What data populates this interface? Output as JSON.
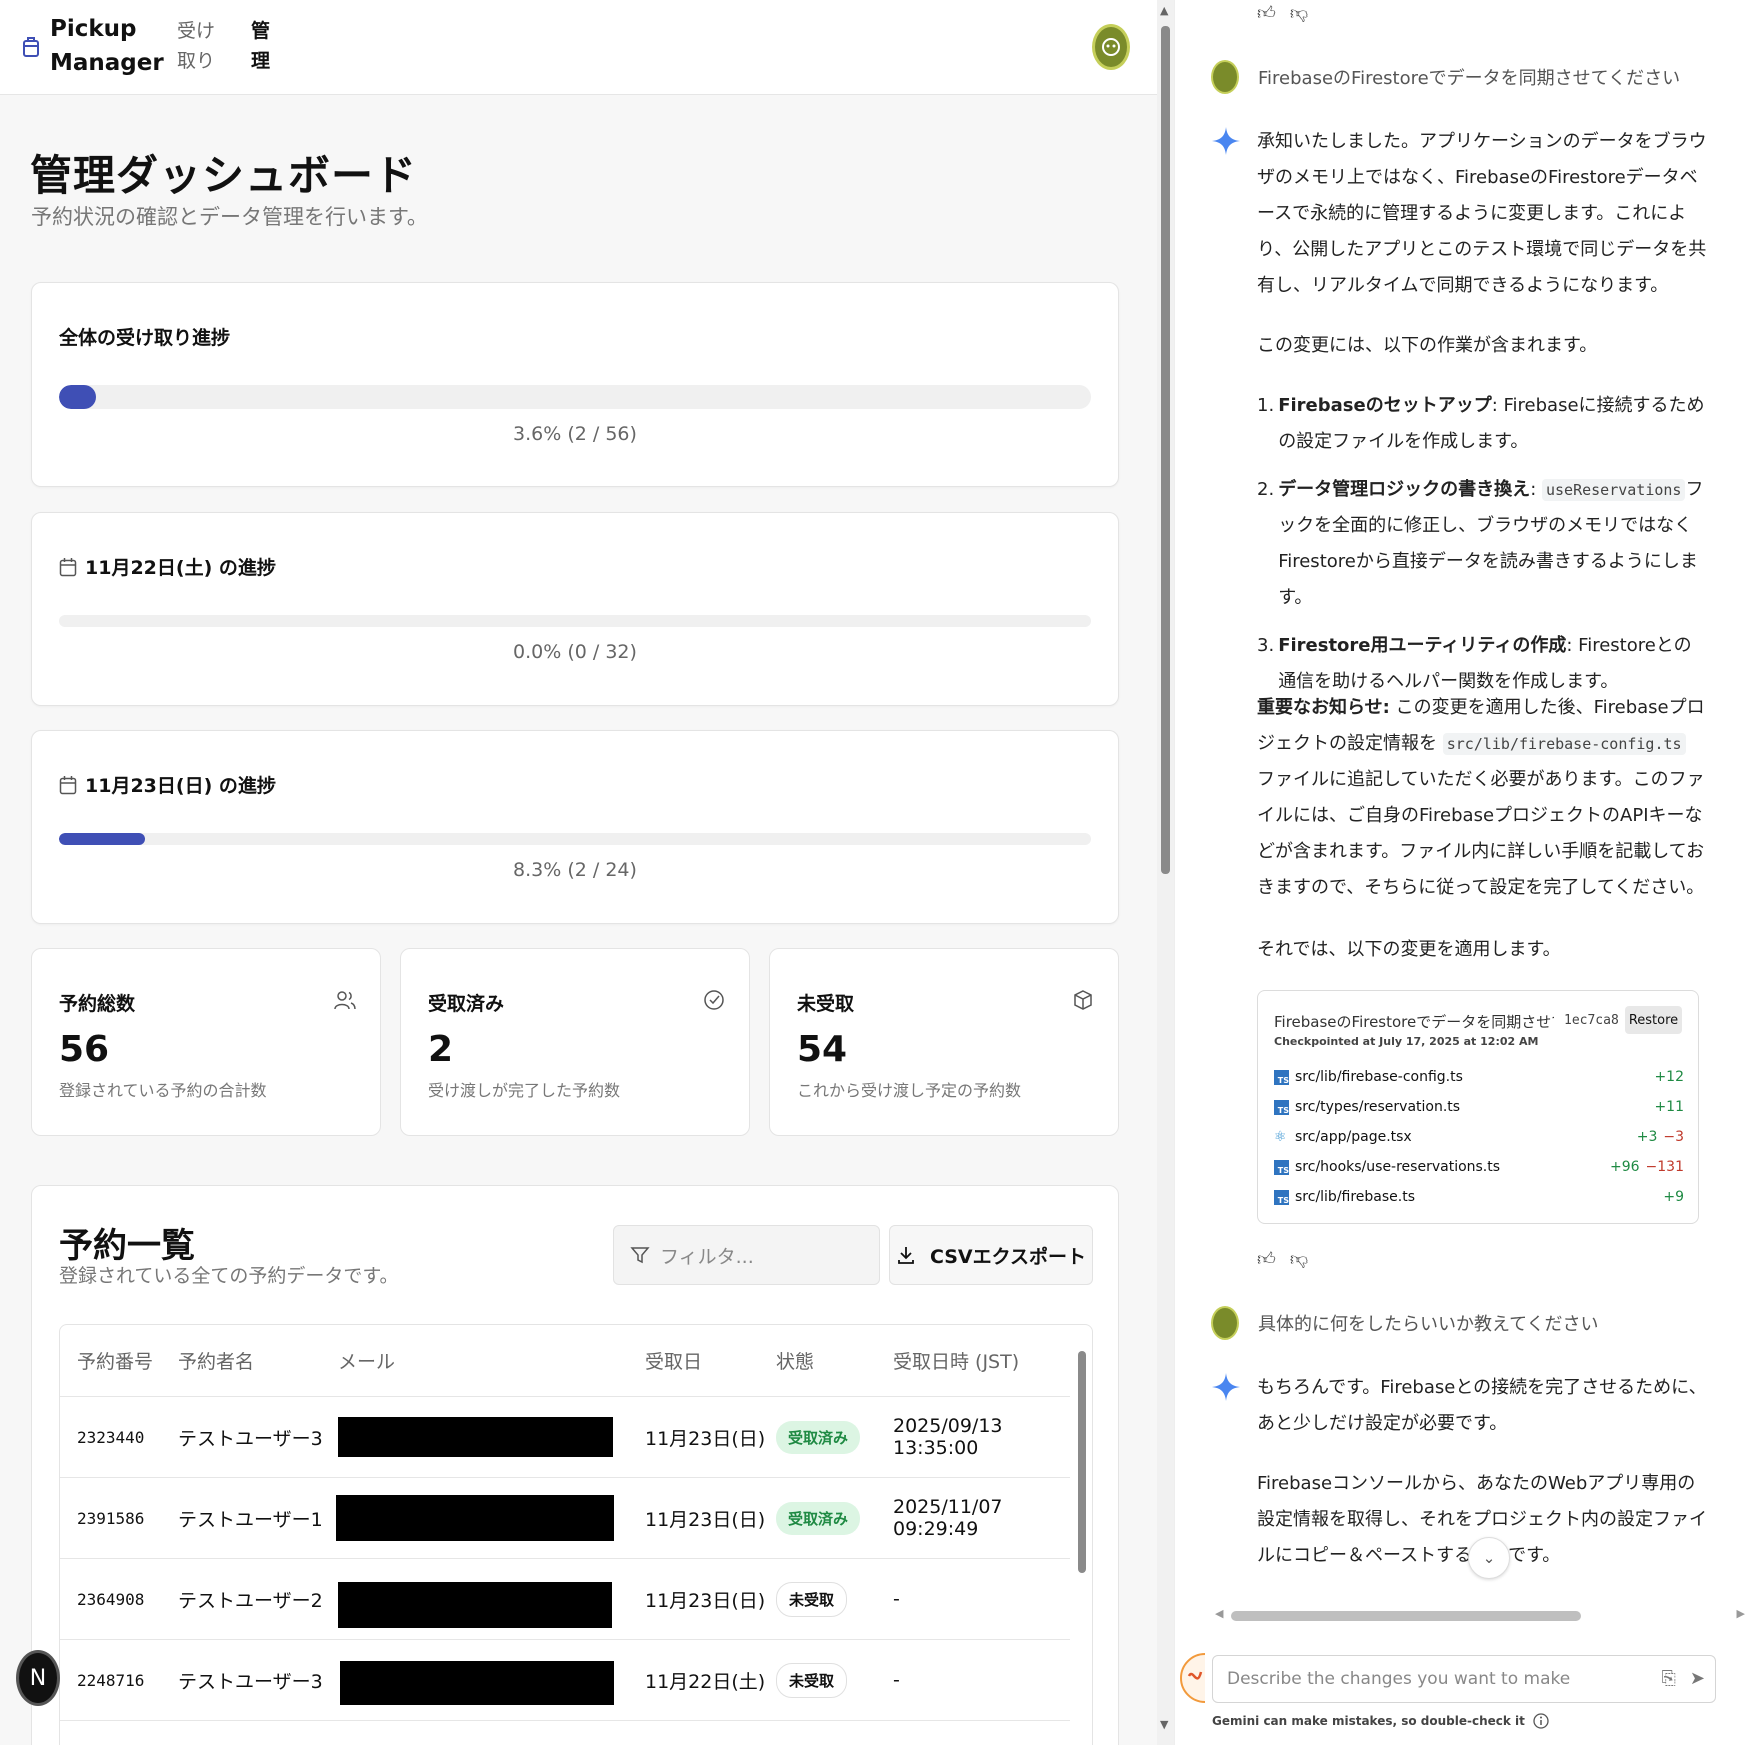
{
  "app": {
    "brand_line1": "Pickup",
    "brand_line2": "Manager",
    "nav": [
      {
        "line1": "受け",
        "line2": "取り"
      },
      {
        "line1": "管",
        "line2": "理"
      }
    ],
    "page_title": "管理ダッシュボード",
    "page_subtitle": "予約状況の確認とデータ管理を行います。",
    "progress": [
      {
        "title": "全体の受け取り進捗",
        "percent_text": "3.6% (2 / 56)",
        "fraction": 0.036
      },
      {
        "title": "11月22日(土) の進捗",
        "percent_text": "0.0% (0 / 32)",
        "fraction": 0.0
      },
      {
        "title": "11月23日(日) の進捗",
        "percent_text": "8.3% (2 / 24)",
        "fraction": 0.083
      }
    ],
    "stats": [
      {
        "label": "予約総数",
        "value": "56",
        "sub": "登録されている予約の合計数",
        "icon": "users-icon"
      },
      {
        "label": "受取済み",
        "value": "2",
        "sub": "受け渡しが完了した予約数",
        "icon": "check-circle-icon"
      },
      {
        "label": "未受取",
        "value": "54",
        "sub": "これから受け渡し予定の予約数",
        "icon": "package-icon"
      }
    ],
    "list": {
      "title": "予約一覧",
      "subtitle": "登録されている全ての予約データです。",
      "filter_placeholder": "フィルタ...",
      "csv_label": "CSVエクスポート",
      "headers": [
        "予約番号",
        "予約者名",
        "メール",
        "受取日",
        "状態",
        "受取日時 (JST)"
      ],
      "rows": [
        {
          "id": "2323440",
          "name": "テストユーザー3",
          "date": "11月23日(日)",
          "status": "受取済み",
          "status_type": "done",
          "time": "2025/09/13 13:35:00"
        },
        {
          "id": "2391586",
          "name": "テストユーザー1",
          "date": "11月23日(日)",
          "status": "受取済み",
          "status_type": "done",
          "time": "2025/11/07 09:29:49"
        },
        {
          "id": "2364908",
          "name": "テストユーザー2",
          "date": "11月23日(日)",
          "status": "未受取",
          "status_type": "pending",
          "time": "-"
        },
        {
          "id": "2248716",
          "name": "テストユーザー3",
          "date": "11月22日(土)",
          "status": "未受取",
          "status_type": "pending",
          "time": "-"
        }
      ]
    },
    "fab_letter": "N",
    "accent": "#3f4fb5"
  },
  "chat": {
    "user_msg_1": "FirebaseのFirestoreでデータを同期させてください",
    "reply_1": "承知いたしました。アプリケーションのデータをブラウザのメモリ上ではなく、FirebaseのFirestoreデータベースで永続的に管理するように変更します。これにより、公開したアプリとこのテスト環境で同じデータを共有し、リアルタイムで同期できるようになります。",
    "reply_2": "この変更には、以下の作業が含まれます。",
    "steps": [
      {
        "bold": "Firebaseのセットアップ",
        "text": ": Firebaseに接続するための設定ファイルを作成します。"
      },
      {
        "bold": "データ管理ロジックの書き換え",
        "text_before": ": ",
        "code": "useReservations",
        "text": "フックを全面的に修正し、ブラウザのメモリではなくFirestoreから直接データを読み書きするようにします。"
      },
      {
        "bold": "Firestore用ユーティリティの作成",
        "text": ": Firestoreとの通信を助けるヘルパー関数を作成します。"
      }
    ],
    "notice_bold": "重要なお知らせ:",
    "notice_before": " この変更を適用した後、Firebaseプロジェクトの設定情報を ",
    "notice_code": "src/lib/firebase-config.ts",
    "notice_after": " ファイルに追記していただく必要があります。このファイルには、ご自身のFirebaseプロジェクトのAPIキーなどが含まれます。ファイル内に詳しい手順を記載しておきますので、そちらに従って設定を完了してください。",
    "reply_3": "それでは、以下の変更を適用します。",
    "checkpoint": {
      "title": "FirebaseのFirestoreでデータを同期させてくだ",
      "sub": "Checkpointed at July 17, 2025 at 12:02 AM",
      "hash": "1ec7ca8",
      "restore": "Restore",
      "files": [
        {
          "path": "src/lib/firebase-config.ts",
          "add": "+12",
          "del": "",
          "icon": "ts"
        },
        {
          "path": "src/types/reservation.ts",
          "add": "+11",
          "del": "",
          "icon": "ts"
        },
        {
          "path": "src/app/page.tsx",
          "add": "+3",
          "del": "−3",
          "icon": "react"
        },
        {
          "path": "src/hooks/use-reservations.ts",
          "add": "+96",
          "del": "−131",
          "icon": "ts"
        },
        {
          "path": "src/lib/firebase.ts",
          "add": "+9",
          "del": "",
          "icon": "ts"
        }
      ]
    },
    "user_msg_2": "具体的に何をしたらいいか教えてください",
    "reply_4": "もちろんです。Firebaseとの接続を完了させるために、あと少しだけ設定が必要です。",
    "reply_5": "Firebaseコンソールから、あなたのWebアプリ専用の設定情報を取得し、それをプロジェクト内の設定ファイルにコピー＆ペーストする作業です。",
    "composer_placeholder": "Describe the changes you want to make",
    "disclaimer": "Gemini can make mistakes, so double-check it"
  }
}
